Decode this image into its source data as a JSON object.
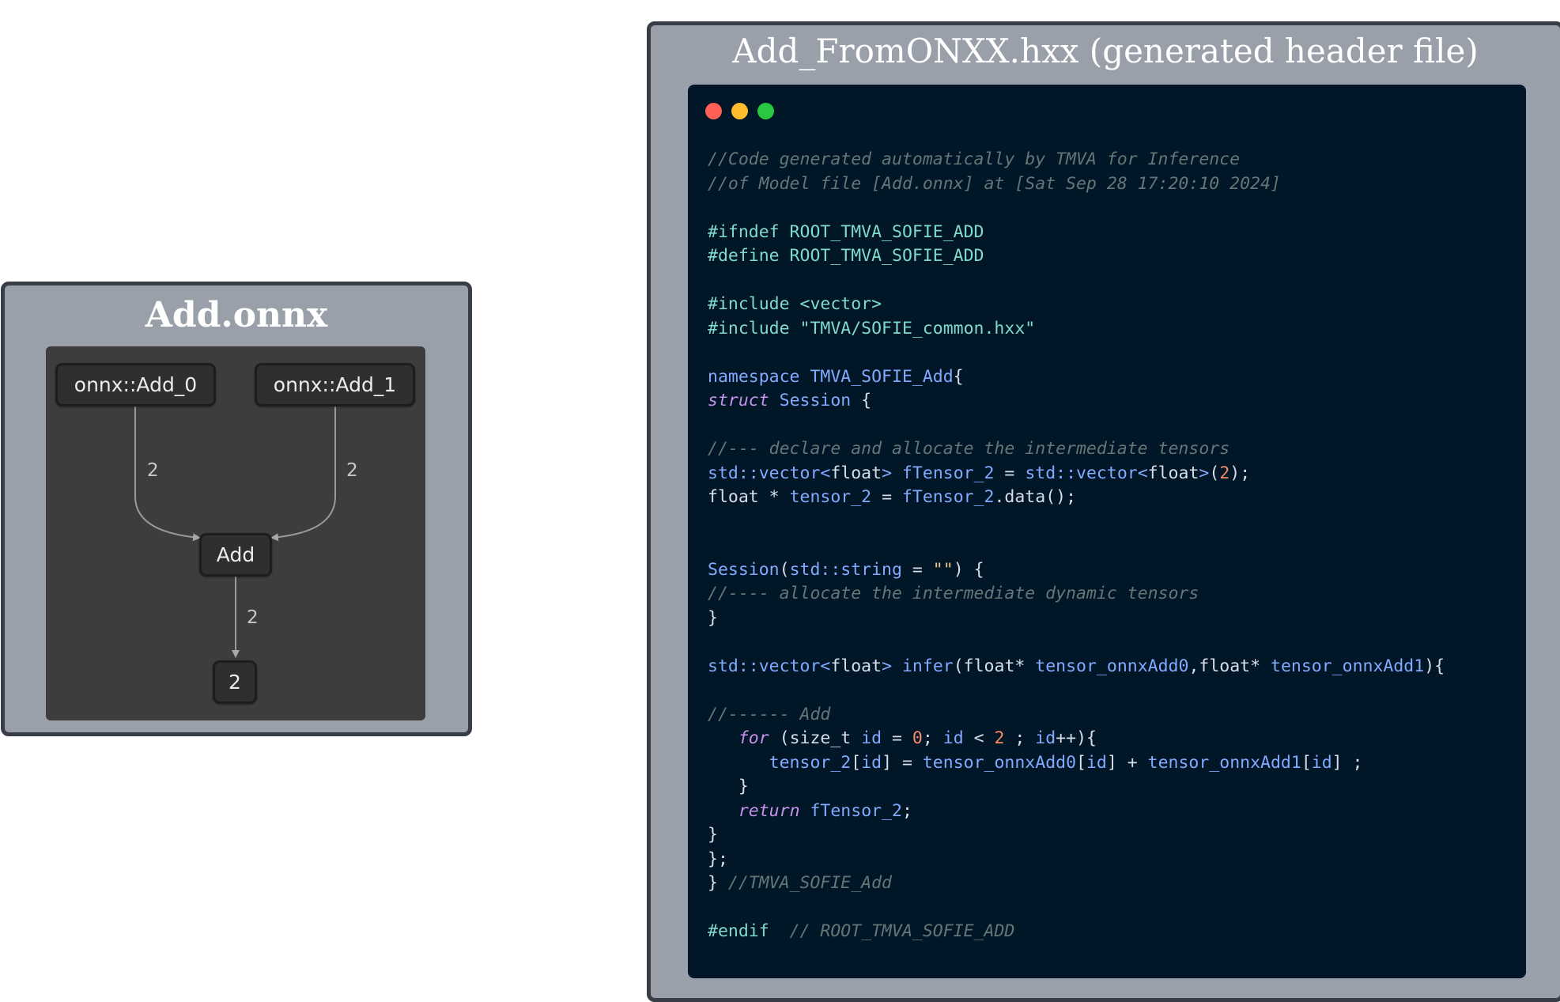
{
  "left_panel": {
    "title": "Add.onnx",
    "nodes": {
      "input_0": "onnx::Add_0",
      "input_1": "onnx::Add_1",
      "op": "Add",
      "output": "2"
    },
    "edge_labels": {
      "input_0_to_op": "2",
      "input_1_to_op": "2",
      "op_to_output": "2"
    }
  },
  "right_panel": {
    "title": "Add_FromONXX.hxx (generated header file)",
    "window_dots": {
      "close": "#ff5f57",
      "minimize": "#febc2e",
      "maximize": "#28c840"
    },
    "code_lines": [
      [
        [
          "comment",
          "//Code generated automatically by TMVA for Inference"
        ]
      ],
      [
        [
          "comment",
          "//of Model file [Add.onnx] at [Sat Sep 28 17:20:10 2024]"
        ]
      ],
      [],
      [
        [
          "pre",
          "#ifndef ROOT_TMVA_SOFIE_ADD"
        ]
      ],
      [
        [
          "pre",
          "#define ROOT_TMVA_SOFIE_ADD"
        ]
      ],
      [],
      [
        [
          "pre",
          "#include <vector>"
        ]
      ],
      [
        [
          "pre",
          "#include \"TMVA/SOFIE_common.hxx\""
        ]
      ],
      [],
      [
        [
          "ns",
          "namespace TMVA_SOFIE_Add"
        ],
        [
          "plain",
          "{"
        ]
      ],
      [
        [
          "kw",
          "struct"
        ],
        [
          "plain",
          " "
        ],
        [
          "ns",
          "Session"
        ],
        [
          "plain",
          " {"
        ]
      ],
      [],
      [
        [
          "comment",
          "//--- declare and allocate the intermediate tensors"
        ]
      ],
      [
        [
          "ns",
          "std::vector<"
        ],
        [
          "plain",
          "float"
        ],
        [
          "ns",
          ">"
        ],
        [
          "plain",
          " "
        ],
        [
          "ns",
          "fTensor_2"
        ],
        [
          "plain",
          " = "
        ],
        [
          "ns",
          "std::vector<"
        ],
        [
          "plain",
          "float"
        ],
        [
          "ns",
          ">"
        ],
        [
          "plain",
          "("
        ],
        [
          "num",
          "2"
        ],
        [
          "plain",
          ");"
        ]
      ],
      [
        [
          "plain",
          "float * "
        ],
        [
          "ns",
          "tensor_2"
        ],
        [
          "plain",
          " = "
        ],
        [
          "ns",
          "fTensor_2"
        ],
        [
          "plain",
          ".data();"
        ]
      ],
      [],
      [],
      [
        [
          "ns",
          "Session"
        ],
        [
          "plain",
          "("
        ],
        [
          "ns",
          "std::string"
        ],
        [
          "plain",
          " = "
        ],
        [
          "str",
          "\"\""
        ],
        [
          "plain",
          ") {"
        ]
      ],
      [
        [
          "comment",
          "//---- allocate the intermediate dynamic tensors"
        ]
      ],
      [
        [
          "plain",
          "}"
        ]
      ],
      [],
      [
        [
          "ns",
          "std::vector<"
        ],
        [
          "plain",
          "float"
        ],
        [
          "ns",
          ">"
        ],
        [
          "plain",
          " "
        ],
        [
          "ns",
          "infer"
        ],
        [
          "plain",
          "(float* "
        ],
        [
          "ns",
          "tensor_onnxAdd0"
        ],
        [
          "plain",
          ",float* "
        ],
        [
          "ns",
          "tensor_onnxAdd1"
        ],
        [
          "plain",
          "){"
        ]
      ],
      [],
      [
        [
          "comment",
          "//------ Add"
        ]
      ],
      [
        [
          "plain",
          "   "
        ],
        [
          "kw",
          "for"
        ],
        [
          "plain",
          " (size_t "
        ],
        [
          "ns",
          "id"
        ],
        [
          "plain",
          " = "
        ],
        [
          "num",
          "0"
        ],
        [
          "plain",
          "; "
        ],
        [
          "ns",
          "id"
        ],
        [
          "plain",
          " < "
        ],
        [
          "num",
          "2"
        ],
        [
          "plain",
          " ; "
        ],
        [
          "ns",
          "id"
        ],
        [
          "plain",
          "++){"
        ]
      ],
      [
        [
          "plain",
          "      "
        ],
        [
          "ns",
          "tensor_2"
        ],
        [
          "plain",
          "["
        ],
        [
          "ns",
          "id"
        ],
        [
          "plain",
          "] = "
        ],
        [
          "ns",
          "tensor_onnxAdd0"
        ],
        [
          "plain",
          "["
        ],
        [
          "ns",
          "id"
        ],
        [
          "plain",
          "] + "
        ],
        [
          "ns",
          "tensor_onnxAdd1"
        ],
        [
          "plain",
          "["
        ],
        [
          "ns",
          "id"
        ],
        [
          "plain",
          "] ;"
        ]
      ],
      [
        [
          "plain",
          "   }"
        ]
      ],
      [
        [
          "plain",
          "   "
        ],
        [
          "kw",
          "return"
        ],
        [
          "plain",
          " "
        ],
        [
          "ns",
          "fTensor_2"
        ],
        [
          "plain",
          ";"
        ]
      ],
      [
        [
          "plain",
          "}"
        ]
      ],
      [
        [
          "plain",
          "};"
        ]
      ],
      [
        [
          "plain",
          "} "
        ],
        [
          "comment",
          "//TMVA_SOFIE_Add"
        ]
      ],
      [],
      [
        [
          "pre",
          "#endif"
        ],
        [
          "plain",
          "  "
        ],
        [
          "comment",
          "// ROOT_TMVA_SOFIE_ADD"
        ]
      ]
    ]
  }
}
